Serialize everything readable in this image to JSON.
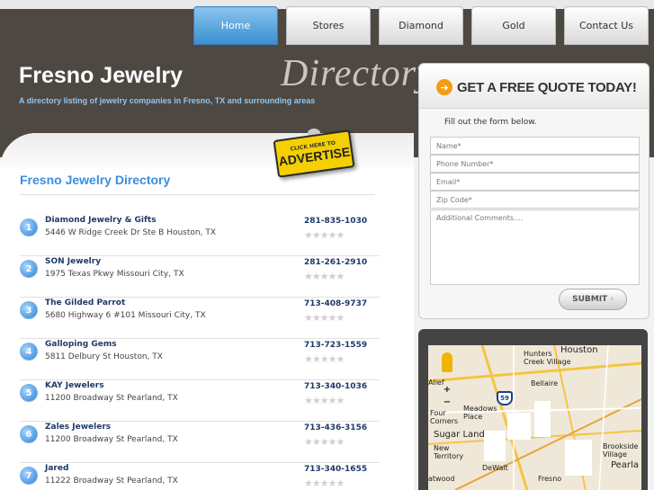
{
  "nav": {
    "tabs": [
      {
        "label": "Home",
        "active": true
      },
      {
        "label": "Stores",
        "active": false
      },
      {
        "label": "Diamond",
        "active": false
      },
      {
        "label": "Gold",
        "active": false
      },
      {
        "label": "Contact Us",
        "active": false
      }
    ]
  },
  "header": {
    "title": "Fresno Jewelry",
    "tagline": "A directory listing of jewelry companies in Fresno, TX and surrounding areas",
    "script_word": "Directory"
  },
  "advertise": {
    "small_text": "CLICK HERE TO",
    "big_text": "ADVERTISE"
  },
  "directory": {
    "heading": "Fresno Jewelry Directory",
    "listings": [
      {
        "num": "1",
        "name": "Diamond Jewelry & Gifts",
        "address": "5446 W Ridge Creek Dr Ste B Houston, TX",
        "phone": "281-835-1030",
        "stars": "★★★★★"
      },
      {
        "num": "2",
        "name": "SON Jewelry",
        "address": "1975 Texas Pkwy Missouri City, TX",
        "phone": "281-261-2910",
        "stars": "★★★★★"
      },
      {
        "num": "3",
        "name": "The Gilded Parrot",
        "address": "5680 Highway 6 #101 Missouri City, TX",
        "phone": "713-408-9737",
        "stars": "★★★★★"
      },
      {
        "num": "4",
        "name": "Galloping Gems",
        "address": "5811 Delbury St Houston, TX",
        "phone": "713-723-1559",
        "stars": "★★★★★"
      },
      {
        "num": "5",
        "name": "KAY Jewelers",
        "address": "11200 Broadway St Pearland, TX",
        "phone": "713-340-1036",
        "stars": "★★★★★"
      },
      {
        "num": "6",
        "name": "Zales Jewelers",
        "address": "11200 Broadway St Pearland, TX",
        "phone": "713-436-3156",
        "stars": "★★★★★"
      },
      {
        "num": "7",
        "name": "Jared",
        "address": "11222 Broadway St Pearland, TX",
        "phone": "713-340-1655",
        "stars": "★★★★★"
      }
    ]
  },
  "quote": {
    "title": "GET A FREE QUOTE TODAY!",
    "arrow_icon": "➔",
    "intro": "Fill out the form below.",
    "fields": {
      "name": "Name*",
      "phone": "Phone Number*",
      "email": "Email*",
      "zip": "Zip Code*",
      "comments": "Additional Comments...."
    },
    "submit": "SUBMIT",
    "submit_arrow": "›"
  },
  "map": {
    "labels": {
      "houston": "Houston",
      "hunters": "Hunters\nCreek Village",
      "alief": "Alief",
      "bellaire": "Bellaire",
      "meadows": "Meadows\nPlace",
      "four_corners": "Four\nCorners",
      "sugar_land": "Sugar Land",
      "brookside": "Brookside\nVillage",
      "new_territory": "New\nTerritory",
      "pearland": "Pearla",
      "dewalt": "DeWalt",
      "fresno": "Fresno",
      "atwood": "atwood"
    },
    "highway": "59",
    "zoom_in": "+",
    "zoom_out": "−"
  }
}
